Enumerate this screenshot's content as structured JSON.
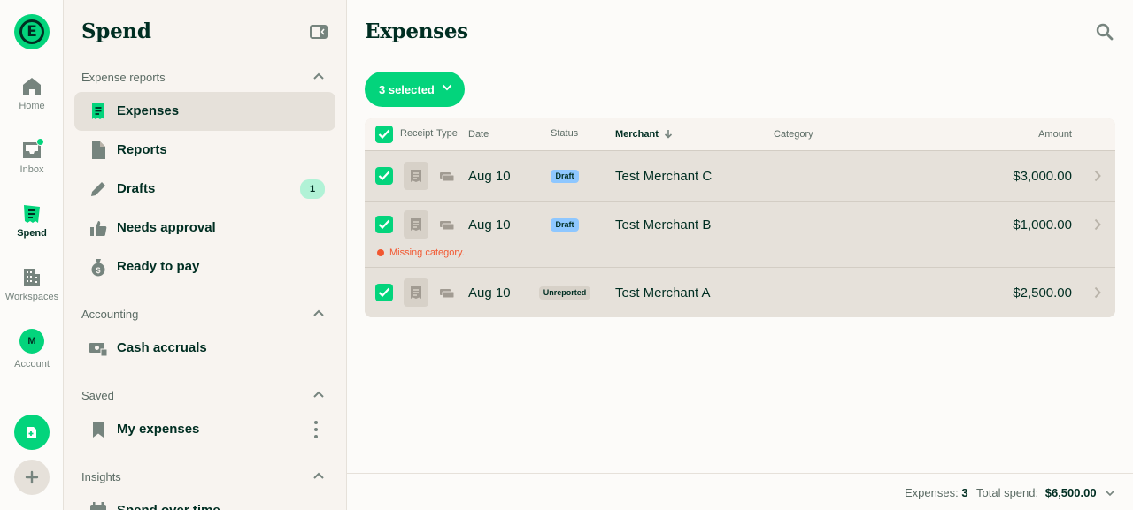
{
  "rail": {
    "logo_letter": "E",
    "items": [
      {
        "label": "Home",
        "icon": "home-icon"
      },
      {
        "label": "Inbox",
        "icon": "inbox-icon"
      },
      {
        "label": "Spend",
        "icon": "receipt-icon"
      },
      {
        "label": "Workspaces",
        "icon": "building-icon"
      },
      {
        "label": "Account",
        "icon": "avatar",
        "initial": "M"
      }
    ],
    "fab_new_icon": "new-expense-icon",
    "fab_add_icon": "plus-icon"
  },
  "sidebar": {
    "title": "Spend",
    "sections": [
      {
        "title": "Expense reports",
        "items": [
          {
            "label": "Expenses",
            "icon": "receipt-icon",
            "active": true
          },
          {
            "label": "Reports",
            "icon": "document-icon"
          },
          {
            "label": "Drafts",
            "icon": "pencil-icon",
            "badge": "1"
          },
          {
            "label": "Needs approval",
            "icon": "thumbs-up-icon"
          },
          {
            "label": "Ready to pay",
            "icon": "money-bag-icon"
          }
        ]
      },
      {
        "title": "Accounting",
        "items": [
          {
            "label": "Cash accruals",
            "icon": "cash-icon"
          }
        ]
      },
      {
        "title": "Saved",
        "items": [
          {
            "label": "My expenses",
            "icon": "bookmark-icon"
          }
        ]
      },
      {
        "title": "Insights",
        "items": [
          {
            "label": "Spend over time",
            "icon": "calendar-icon"
          }
        ]
      }
    ]
  },
  "main": {
    "title": "Expenses",
    "selected_label": "3 selected",
    "columns": {
      "receipt": "Receipt",
      "type": "Type",
      "date": "Date",
      "status": "Status",
      "merchant": "Merchant",
      "category": "Category",
      "amount": "Amount"
    },
    "rows": [
      {
        "date": "Aug 10",
        "status": "Draft",
        "merchant": "Test Merchant C",
        "amount": "$3,000.00",
        "warning": ""
      },
      {
        "date": "Aug 10",
        "status": "Draft",
        "merchant": "Test Merchant B",
        "amount": "$1,000.00",
        "warning": "Missing category."
      },
      {
        "date": "Aug 10",
        "status": "Unreported",
        "merchant": "Test Merchant A",
        "amount": "$2,500.00",
        "warning": ""
      }
    ],
    "footer": {
      "expenses_label": "Expenses:",
      "expenses_count": "3",
      "total_label": "Total spend:",
      "total_value": "$6,500.00"
    }
  },
  "colors": {
    "accent": "#03d47c",
    "text": "#002e22",
    "draft": "#8ec7ff",
    "danger": "#f25730"
  }
}
